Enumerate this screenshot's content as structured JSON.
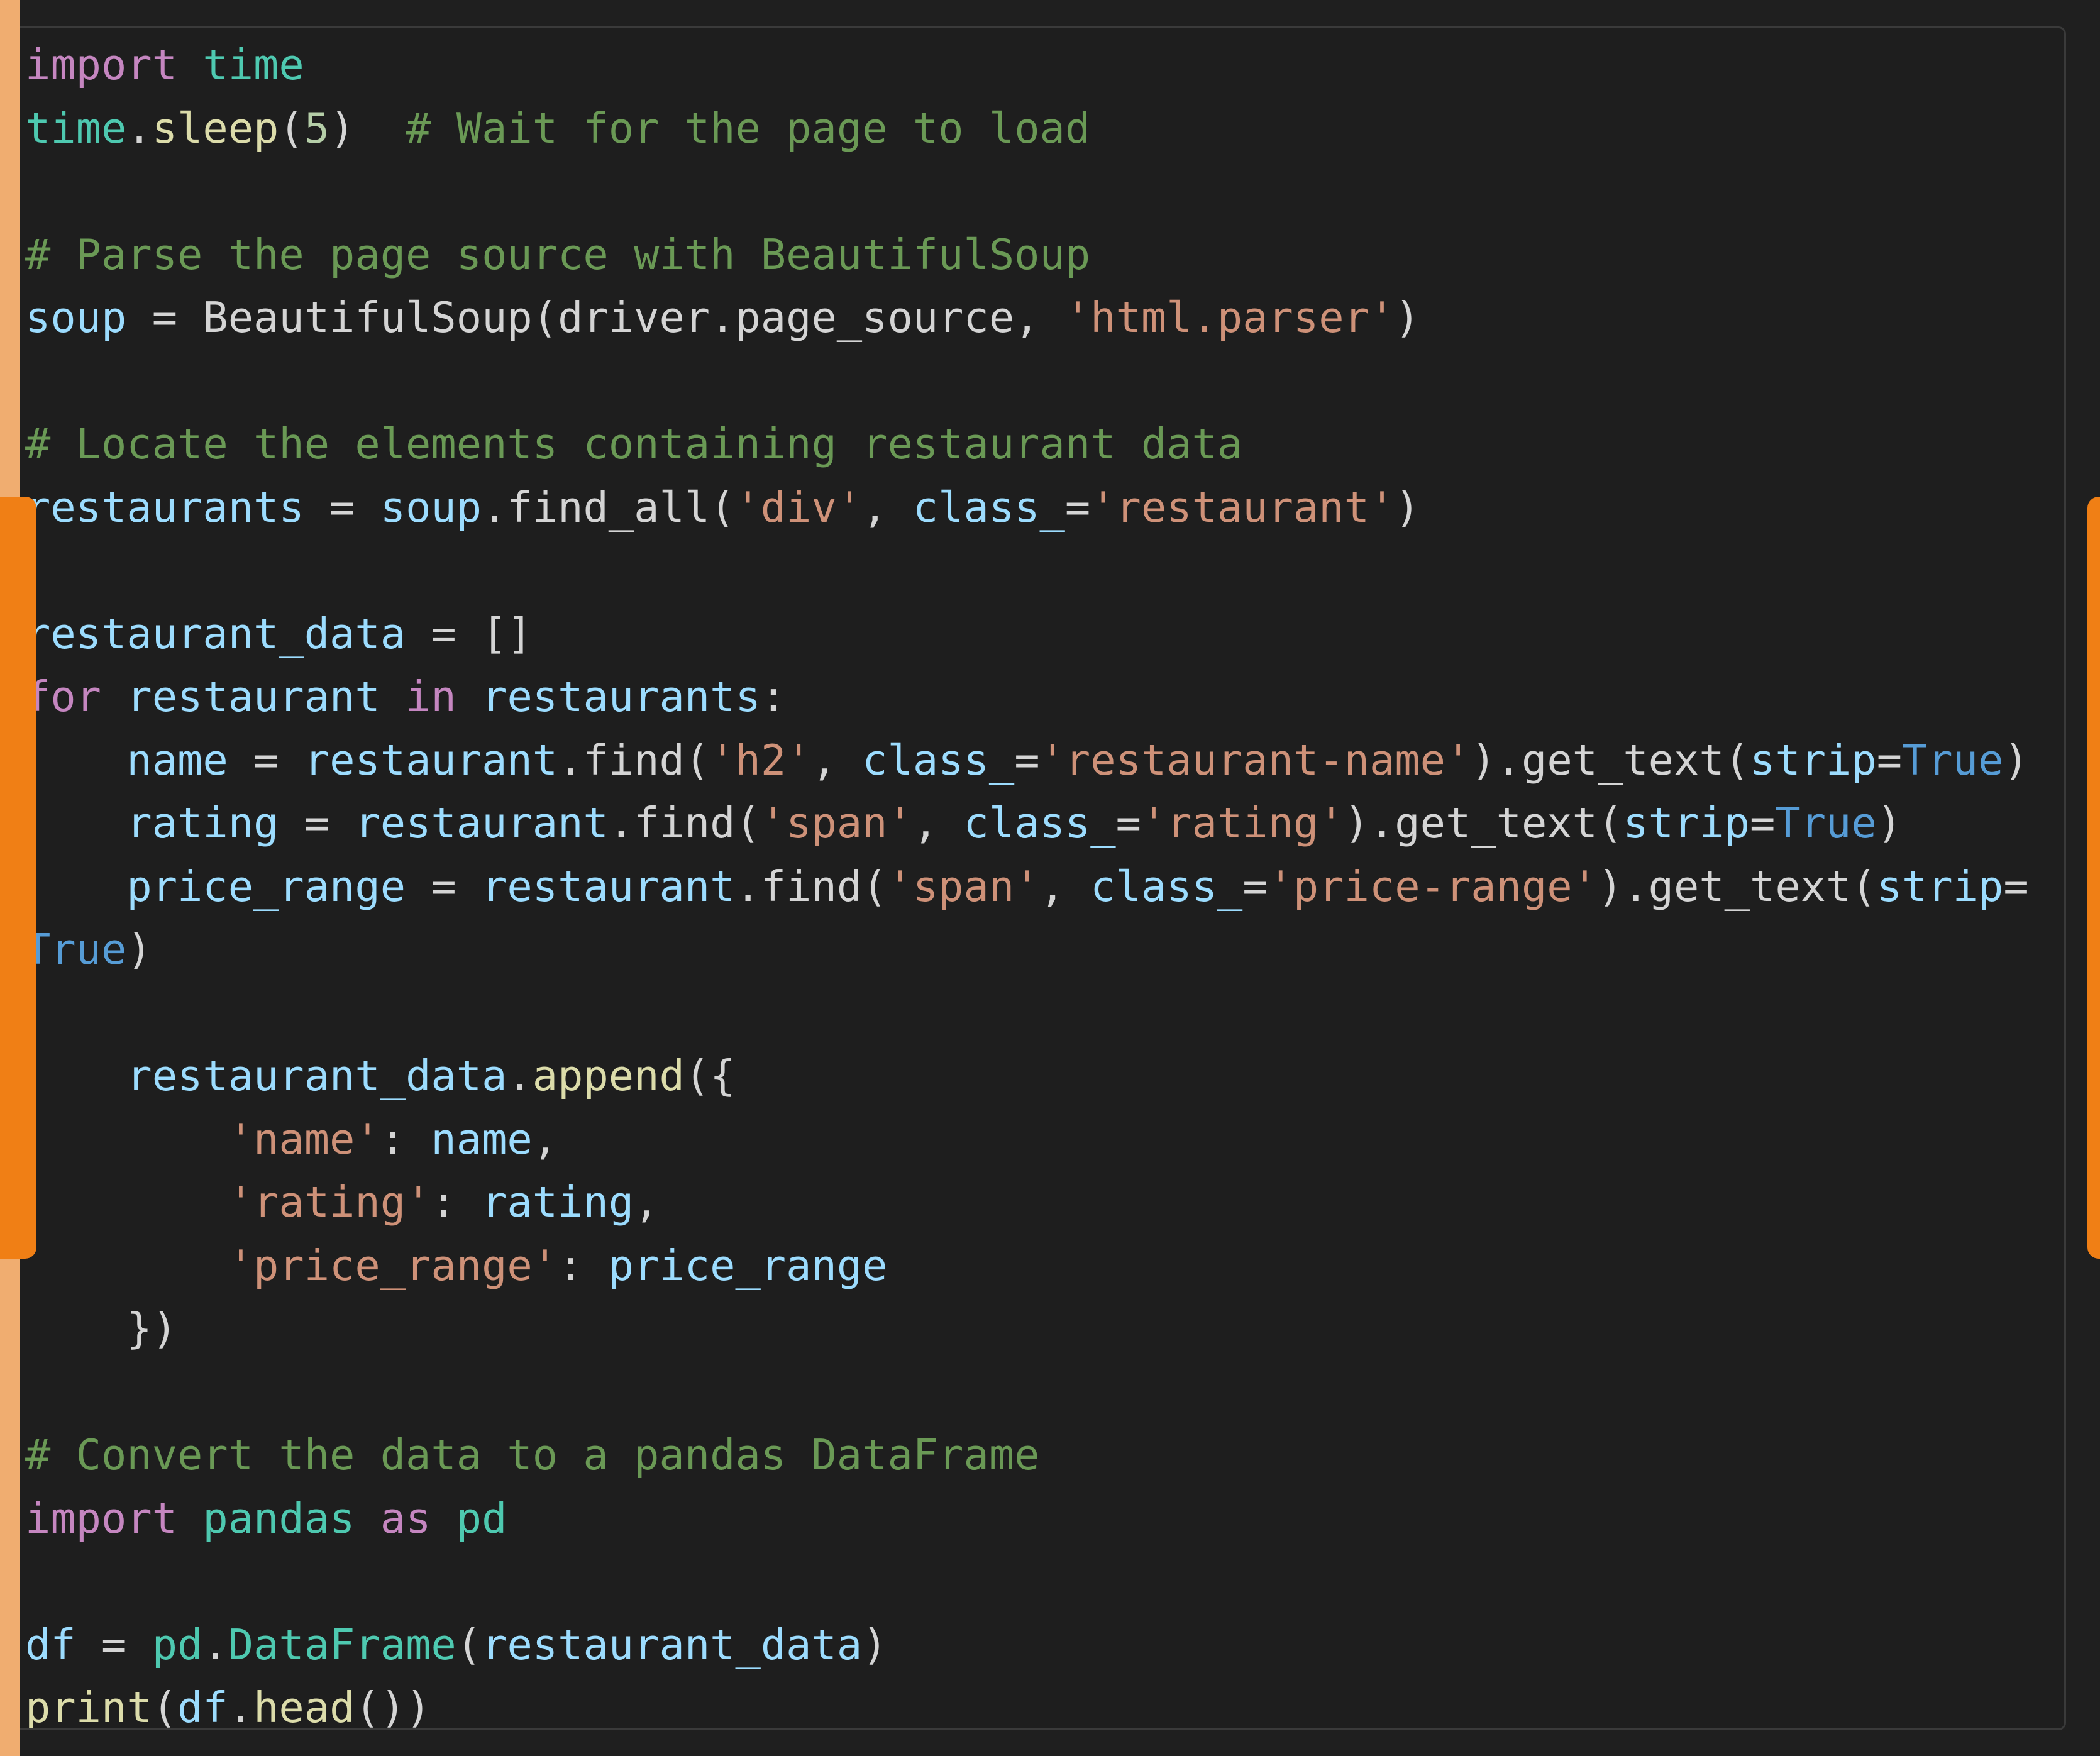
{
  "colors": {
    "background": "#1f1f1f",
    "panel": "#1e1e1e",
    "accent_orange": "#f07f15",
    "accent_light": "#f0ad70",
    "keyword": "#c586c0",
    "module": "#4ec9b0",
    "function": "#dcdcaa",
    "variable": "#9cdcfe",
    "string": "#ce9178",
    "number": "#b5cea8",
    "comment": "#6a9955",
    "boolean": "#569cd6",
    "plain": "#d4d4d4"
  },
  "code": {
    "language": "python",
    "lines": [
      [
        {
          "t": "kw",
          "v": "import"
        },
        {
          "t": "pl",
          "v": " "
        },
        {
          "t": "mod",
          "v": "time"
        }
      ],
      [
        {
          "t": "mod",
          "v": "time"
        },
        {
          "t": "pl",
          "v": "."
        },
        {
          "t": "fn",
          "v": "sleep"
        },
        {
          "t": "pl",
          "v": "("
        },
        {
          "t": "num",
          "v": "5"
        },
        {
          "t": "pl",
          "v": ")  "
        },
        {
          "t": "cm",
          "v": "# Wait for the page to load"
        }
      ],
      [],
      [
        {
          "t": "cm",
          "v": "# Parse the page source with BeautifulSoup"
        }
      ],
      [
        {
          "t": "var",
          "v": "soup"
        },
        {
          "t": "pl",
          "v": " = BeautifulSoup(driver.page_source, "
        },
        {
          "t": "str",
          "v": "'html.parser'"
        },
        {
          "t": "pl",
          "v": ")"
        }
      ],
      [],
      [
        {
          "t": "cm",
          "v": "# Locate the elements containing restaurant data"
        }
      ],
      [
        {
          "t": "var",
          "v": "restaurants"
        },
        {
          "t": "pl",
          "v": " = "
        },
        {
          "t": "var",
          "v": "soup"
        },
        {
          "t": "pl",
          "v": ".find_all("
        },
        {
          "t": "str",
          "v": "'div'"
        },
        {
          "t": "pl",
          "v": ", "
        },
        {
          "t": "var",
          "v": "class_"
        },
        {
          "t": "pl",
          "v": "="
        },
        {
          "t": "str",
          "v": "'restaurant'"
        },
        {
          "t": "pl",
          "v": ")"
        }
      ],
      [],
      [
        {
          "t": "var",
          "v": "restaurant_data"
        },
        {
          "t": "pl",
          "v": " = []"
        }
      ],
      [
        {
          "t": "kw",
          "v": "for"
        },
        {
          "t": "pl",
          "v": " "
        },
        {
          "t": "var",
          "v": "restaurant"
        },
        {
          "t": "pl",
          "v": " "
        },
        {
          "t": "kw",
          "v": "in"
        },
        {
          "t": "pl",
          "v": " "
        },
        {
          "t": "var",
          "v": "restaurants"
        },
        {
          "t": "pl",
          "v": ":"
        }
      ],
      [
        {
          "t": "pl",
          "v": "    "
        },
        {
          "t": "var",
          "v": "name"
        },
        {
          "t": "pl",
          "v": " = "
        },
        {
          "t": "var",
          "v": "restaurant"
        },
        {
          "t": "pl",
          "v": ".find("
        },
        {
          "t": "str",
          "v": "'h2'"
        },
        {
          "t": "pl",
          "v": ", "
        },
        {
          "t": "var",
          "v": "class_"
        },
        {
          "t": "pl",
          "v": "="
        },
        {
          "t": "str",
          "v": "'restaurant-name'"
        },
        {
          "t": "pl",
          "v": ").get_text("
        },
        {
          "t": "var",
          "v": "strip"
        },
        {
          "t": "pl",
          "v": "="
        },
        {
          "t": "bool",
          "v": "True"
        },
        {
          "t": "pl",
          "v": ")"
        }
      ],
      [
        {
          "t": "pl",
          "v": "    "
        },
        {
          "t": "var",
          "v": "rating"
        },
        {
          "t": "pl",
          "v": " = "
        },
        {
          "t": "var",
          "v": "restaurant"
        },
        {
          "t": "pl",
          "v": ".find("
        },
        {
          "t": "str",
          "v": "'span'"
        },
        {
          "t": "pl",
          "v": ", "
        },
        {
          "t": "var",
          "v": "class_"
        },
        {
          "t": "pl",
          "v": "="
        },
        {
          "t": "str",
          "v": "'rating'"
        },
        {
          "t": "pl",
          "v": ").get_text("
        },
        {
          "t": "var",
          "v": "strip"
        },
        {
          "t": "pl",
          "v": "="
        },
        {
          "t": "bool",
          "v": "True"
        },
        {
          "t": "pl",
          "v": ")"
        }
      ],
      [
        {
          "t": "pl",
          "v": "    "
        },
        {
          "t": "var",
          "v": "price_range"
        },
        {
          "t": "pl",
          "v": " = "
        },
        {
          "t": "var",
          "v": "restaurant"
        },
        {
          "t": "pl",
          "v": ".find("
        },
        {
          "t": "str",
          "v": "'span'"
        },
        {
          "t": "pl",
          "v": ", "
        },
        {
          "t": "var",
          "v": "class_"
        },
        {
          "t": "pl",
          "v": "="
        },
        {
          "t": "str",
          "v": "'price-range'"
        },
        {
          "t": "pl",
          "v": ").get_text("
        },
        {
          "t": "var",
          "v": "strip"
        },
        {
          "t": "pl",
          "v": "="
        }
      ],
      [
        {
          "t": "bool",
          "v": "True"
        },
        {
          "t": "pl",
          "v": ")"
        }
      ],
      [],
      [
        {
          "t": "pl",
          "v": "    "
        },
        {
          "t": "var",
          "v": "restaurant_data"
        },
        {
          "t": "pl",
          "v": "."
        },
        {
          "t": "fn",
          "v": "append"
        },
        {
          "t": "pl",
          "v": "({"
        }
      ],
      [
        {
          "t": "pl",
          "v": "        "
        },
        {
          "t": "str",
          "v": "'name'"
        },
        {
          "t": "pl",
          "v": ": "
        },
        {
          "t": "var",
          "v": "name"
        },
        {
          "t": "pl",
          "v": ","
        }
      ],
      [
        {
          "t": "pl",
          "v": "        "
        },
        {
          "t": "str",
          "v": "'rating'"
        },
        {
          "t": "pl",
          "v": ": "
        },
        {
          "t": "var",
          "v": "rating"
        },
        {
          "t": "pl",
          "v": ","
        }
      ],
      [
        {
          "t": "pl",
          "v": "        "
        },
        {
          "t": "str",
          "v": "'price_range'"
        },
        {
          "t": "pl",
          "v": ": "
        },
        {
          "t": "var",
          "v": "price_range"
        }
      ],
      [
        {
          "t": "pl",
          "v": "    })"
        }
      ],
      [],
      [
        {
          "t": "cm",
          "v": "# Convert the data to a pandas DataFrame"
        }
      ],
      [
        {
          "t": "kw",
          "v": "import"
        },
        {
          "t": "pl",
          "v": " "
        },
        {
          "t": "mod",
          "v": "pandas"
        },
        {
          "t": "pl",
          "v": " "
        },
        {
          "t": "kw",
          "v": "as"
        },
        {
          "t": "pl",
          "v": " "
        },
        {
          "t": "mod",
          "v": "pd"
        }
      ],
      [],
      [
        {
          "t": "var",
          "v": "df"
        },
        {
          "t": "pl",
          "v": " = "
        },
        {
          "t": "mod",
          "v": "pd"
        },
        {
          "t": "pl",
          "v": "."
        },
        {
          "t": "mod",
          "v": "DataFrame"
        },
        {
          "t": "pl",
          "v": "("
        },
        {
          "t": "var",
          "v": "restaurant_data"
        },
        {
          "t": "pl",
          "v": ")"
        }
      ],
      [
        {
          "t": "fn",
          "v": "print"
        },
        {
          "t": "pl",
          "v": "("
        },
        {
          "t": "var",
          "v": "df"
        },
        {
          "t": "pl",
          "v": "."
        },
        {
          "t": "fn",
          "v": "head"
        },
        {
          "t": "pl",
          "v": "())"
        }
      ]
    ]
  }
}
